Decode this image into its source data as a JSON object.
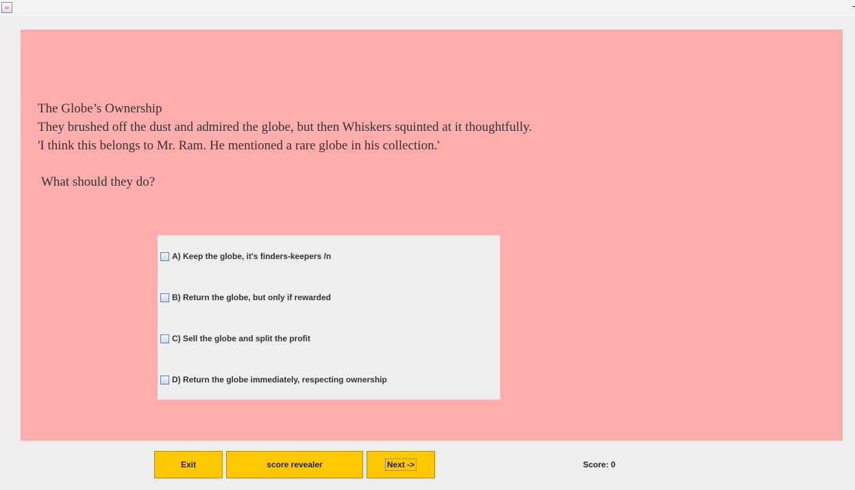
{
  "window": {
    "icon": "java-cup-icon",
    "icon_glyph": "☕"
  },
  "story": {
    "lines": "The Globe’s Ownership\nThey brushed off the dust and admired the globe, but then Whiskers squinted at it thoughtfully.\n'I think this belongs to Mr. Ram. He mentioned a rare globe in his collection.'",
    "question": "What should they do?"
  },
  "options": [
    {
      "label": "A) Keep the globe, it's finders-keepers /n",
      "checked": false
    },
    {
      "label": "B) Return the globe, but only if rewarded",
      "checked": false
    },
    {
      "label": "C) Sell the globe and split the profit",
      "checked": false
    },
    {
      "label": "D) Return the globe immediately, respecting ownership",
      "checked": false
    }
  ],
  "buttons": {
    "exit": "Exit",
    "score_revealer": "score revealer",
    "next": "Next ->"
  },
  "score": "Score: 0",
  "colors": {
    "panel": "#ffadad",
    "button": "#ffc800",
    "background": "#eeeeee"
  }
}
